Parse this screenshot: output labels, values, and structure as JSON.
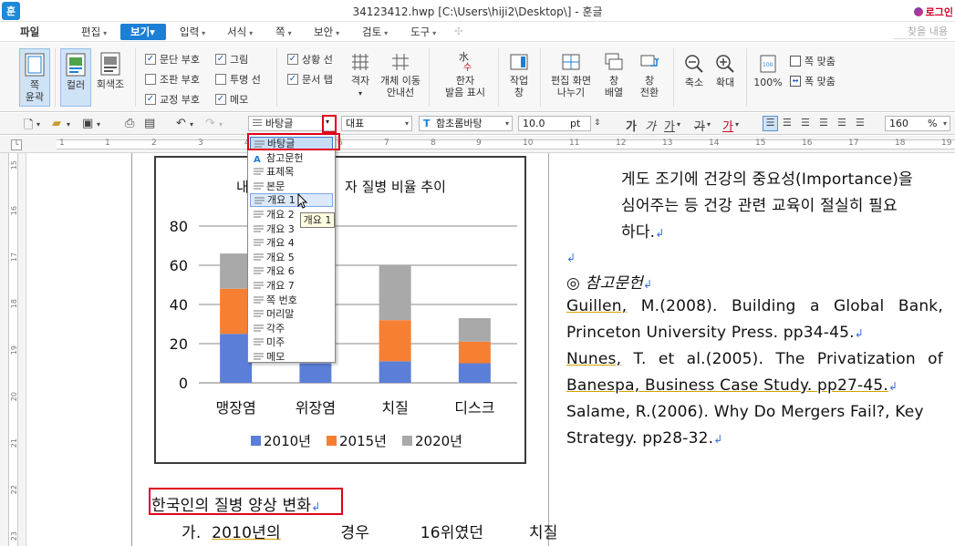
{
  "window": {
    "app_icon": "훈",
    "title": "34123412.hwp [C:\\Users\\hiji2\\Desktop\\] - 훈글",
    "login_label": "로그인"
  },
  "menubar": {
    "file": "파일",
    "items": [
      "편집",
      "보기",
      "입력",
      "서식",
      "쪽",
      "보안",
      "검토",
      "도구"
    ],
    "active": "보기",
    "search_placeholder": "찾을 내용"
  },
  "ribbon": {
    "page_outline": "쪽\n윤곽",
    "color": "컬러",
    "grayscale": "회색조",
    "checkboxes": [
      {
        "label": "문단 부호",
        "checked": true
      },
      {
        "label": "조판 부호",
        "checked": false
      },
      {
        "label": "교정 부호",
        "checked": true
      },
      {
        "label": "그림",
        "checked": true
      },
      {
        "label": "투명 선",
        "checked": false
      },
      {
        "label": "메모",
        "checked": true
      },
      {
        "label": "상황 선",
        "checked": true
      },
      {
        "label": "문서 탭",
        "checked": true
      }
    ],
    "grid": "격자",
    "object_move_guide": "개체 이동\n안내선",
    "hanja_pronunciation": "한자\n발음 표시",
    "task_window": "작업\n창",
    "split_screen": "편집 화면\n나누기",
    "window_arrange": "창\n배열",
    "window_switch": "창\n전환",
    "zoom_out": "축소",
    "zoom_in": "확대",
    "zoom_100": "100%",
    "fit_page": "쪽 맞춤",
    "fit_width": "폭 맞춤"
  },
  "format_toolbar": {
    "style_value": "바탕글",
    "rep_value": "대표",
    "font_value": "함초롬바탕",
    "size_value": "10.0",
    "size_unit": "pt",
    "zoom_value": "160",
    "zoom_unit": "%"
  },
  "ruler": {
    "h_labels": [
      "1",
      "1",
      "2",
      "3",
      "4",
      "5",
      "6",
      "7",
      "8",
      "9",
      "10",
      "11",
      "12",
      "13",
      "14",
      "15",
      "16",
      "17",
      "18",
      "19"
    ],
    "v_labels": [
      "15",
      "16",
      "17",
      "18",
      "19",
      "20",
      "21",
      "22",
      "23"
    ]
  },
  "style_dropdown": {
    "items": [
      "바탕글",
      "참고문헌",
      "표제목",
      "본문",
      "개요 1",
      "개요 2",
      "개요 3",
      "개요 4",
      "개요 5",
      "개요 6",
      "개요 7",
      "쪽 번호",
      "머리말",
      "각주",
      "미주",
      "메모"
    ],
    "selected": "바탕글",
    "hovered": "개요 1",
    "tooltip": "개요 1"
  },
  "chart_data": {
    "type": "bar",
    "stacked": true,
    "title": "내국인 환자 질병 비율 추이",
    "title_visible_parts": [
      "내",
      "자 질병 비율 추이"
    ],
    "categories": [
      "맹장염",
      "위장염",
      "치질",
      "디스크"
    ],
    "series": [
      {
        "name": "2010년",
        "color": "#5b7fd8",
        "values": [
          25,
          10,
          11,
          10
        ]
      },
      {
        "name": "2015년",
        "color": "#f77f32",
        "values": [
          23,
          0,
          21,
          11
        ]
      },
      {
        "name": "2020년",
        "color": "#a9a9a9",
        "values": [
          18,
          0,
          28,
          12
        ]
      }
    ],
    "ylim": [
      0,
      80
    ],
    "yticks": [
      "0",
      "20",
      "40",
      "60",
      "80"
    ],
    "grid": true,
    "legend_position": "bottom"
  },
  "document": {
    "left_heading": "한국인의 질병 양상 변화",
    "left_para": [
      "가.",
      "2010년의",
      "경우",
      "16위였던",
      "치질"
    ],
    "right_lines": [
      "게도 조기에 건강의 중요성(Importance)을",
      "심어주는 등 건강 관련 교육이 절실히 필요",
      "하다."
    ],
    "ref_heading": "◎ 참고문헌",
    "references": [
      [
        "Guillen,",
        "M.(2008).",
        "Building",
        "a",
        "Global",
        "Bank,"
      ],
      [
        "Princeton University Press. pp34-45."
      ],
      [
        "Nunes,",
        "T.",
        "et",
        "al.(2005).",
        "The",
        "Privatization",
        "of"
      ],
      [
        "Banespa, Business Case Study. pp27-45."
      ],
      [
        "Salame, R.(2006). Why Do Mergers Fail?, Key"
      ],
      [
        "Strategy. pp28-32."
      ]
    ]
  }
}
